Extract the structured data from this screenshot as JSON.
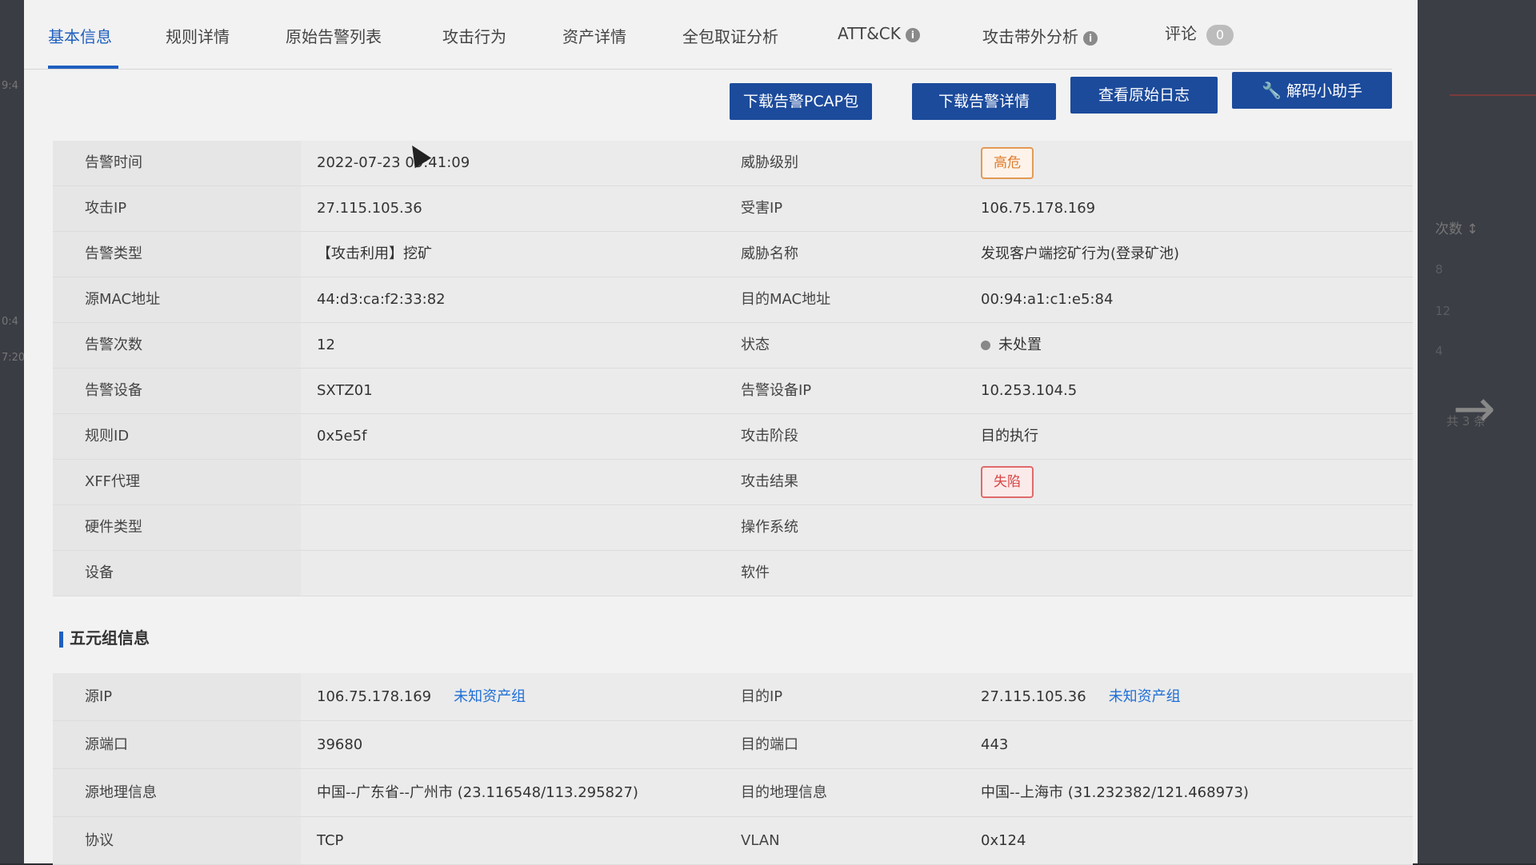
{
  "tabs": [
    {
      "label": "基本信息",
      "active": true
    },
    {
      "label": "规则详情"
    },
    {
      "label": "原始告警列表"
    },
    {
      "label": "攻击行为"
    },
    {
      "label": "资产详情"
    },
    {
      "label": "全包取证分析"
    },
    {
      "label": "ATT&CK",
      "info": "i"
    },
    {
      "label": "攻击带外分析",
      "info": "i"
    },
    {
      "label": "评论",
      "count": "0"
    }
  ],
  "toolbar": {
    "download_pcap": "下载告警PCAP包",
    "download_detail": "下载告警详情",
    "view_log": "查看原始日志",
    "decode_helper": "解码小助手"
  },
  "basic": [
    {
      "l1": "告警时间",
      "v1": "2022-07-23 09:41:09",
      "l2": "威胁级别",
      "v2": "高危"
    },
    {
      "l1": "攻击IP",
      "v1": "27.115.105.36",
      "l2": "受害IP",
      "v2": "106.75.178.169"
    },
    {
      "l1": "告警类型",
      "v1": "【攻击利用】挖矿",
      "l2": "威胁名称",
      "v2": "发现客户端挖矿行为(登录矿池)"
    },
    {
      "l1": "源MAC地址",
      "v1": "44:d3:ca:f2:33:82",
      "l2": "目的MAC地址",
      "v2": "00:94:a1:c1:e5:84"
    },
    {
      "l1": "告警次数",
      "v1": "12",
      "l2": "状态",
      "v2": "未处置"
    },
    {
      "l1": "告警设备",
      "v1": "SXTZ01",
      "l2": "告警设备IP",
      "v2": "10.253.104.5"
    },
    {
      "l1": "规则ID",
      "v1": "0x5e5f",
      "l2": "攻击阶段",
      "v2": "目的执行"
    },
    {
      "l1": "XFF代理",
      "v1": "",
      "l2": "攻击结果",
      "v2": "失陷"
    },
    {
      "l1": "硬件类型",
      "v1": "",
      "l2": "操作系统",
      "v2": ""
    },
    {
      "l1": "设备",
      "v1": "",
      "l2": "软件",
      "v2": ""
    }
  ],
  "five_tuple": {
    "title": "五元组信息",
    "asset_link": "未知资产组",
    "rows": [
      {
        "l1": "源IP",
        "v1": "106.75.178.169",
        "l2": "目的IP",
        "v2": "27.115.105.36"
      },
      {
        "l1": "源端口",
        "v1": "39680",
        "l2": "目的端口",
        "v2": "443"
      },
      {
        "l1": "源地理信息",
        "v1": "中国--广东省--广州市 (23.116548/113.295827)",
        "l2": "目的地理信息",
        "v2": "中国--上海市 (31.232382/121.468973)"
      },
      {
        "l1": "协议",
        "v1": "TCP",
        "l2": "VLAN",
        "v2": "0x124"
      }
    ]
  },
  "background": {
    "right_header": "次数 ↕",
    "right_values": [
      "8",
      "12",
      "4"
    ],
    "right_footer": "共 3 条",
    "left_fragments": [
      "9:4",
      "0:4",
      "7:20"
    ]
  },
  "colors": {
    "accent": "#1f5fbf",
    "button": "#1c4b9c",
    "danger": "#d94444",
    "warning": "#e07b2a"
  }
}
